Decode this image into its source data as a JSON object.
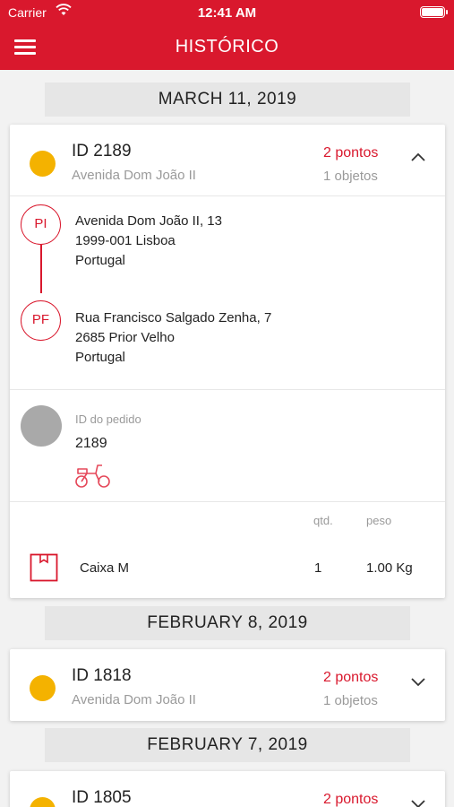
{
  "status_bar": {
    "carrier": "Carrier",
    "time": "12:41 AM"
  },
  "header": {
    "title": "HISTÓRICO"
  },
  "sections": [
    {
      "date": "MARCH 11, 2019",
      "card": {
        "id": "ID 2189",
        "address": "Avenida Dom João II",
        "points": "2 pontos",
        "objects": "1 objetos",
        "expanded": true,
        "status_color": "#f4b200",
        "pickup": {
          "label": "PI",
          "lines": [
            "Avenida Dom João II, 13",
            "1999-001 Lisboa",
            "Portugal"
          ]
        },
        "dropoff": {
          "label": "PF",
          "lines": [
            "Rua Francisco Salgado Zenha, 7",
            "2685 Prior Velho",
            "Portugal"
          ]
        },
        "order_label": "ID do pedido",
        "order_id": "2189",
        "vehicle_icon": "scooter-icon",
        "items_header": {
          "qty": "qtd.",
          "weight": "peso"
        },
        "items": [
          {
            "name": "Caixa M",
            "qty": "1",
            "weight": "1.00 Kg",
            "icon": "box-icon"
          }
        ]
      }
    },
    {
      "date": "FEBRUARY 8, 2019",
      "card": {
        "id": "ID 1818",
        "address": "Avenida Dom João II",
        "points": "2 pontos",
        "objects": "1 objetos",
        "expanded": false,
        "status_color": "#f4b200"
      }
    },
    {
      "date": "FEBRUARY 7, 2019",
      "card": {
        "id": "ID 1805",
        "points": "2 pontos",
        "expanded": false,
        "status_color": "#f4b200"
      }
    }
  ],
  "colors": {
    "brand": "#d9182d",
    "pending": "#f4b200"
  }
}
